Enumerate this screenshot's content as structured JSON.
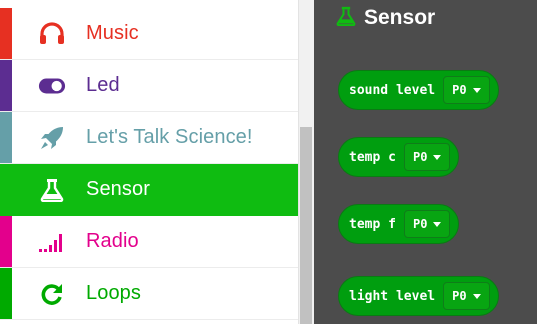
{
  "toolbox": {
    "categories": [
      {
        "label": "Music",
        "color": "#e63022",
        "icon": "headphones-icon"
      },
      {
        "label": "Led",
        "color": "#5c2d91",
        "icon": "toggle-icon"
      },
      {
        "label": "Let's Talk Science!",
        "color": "#659fa8",
        "icon": "rocket-icon"
      },
      {
        "label": "Sensor",
        "color": "#0fbc11",
        "icon": "flask-icon",
        "selected": true
      },
      {
        "label": "Radio",
        "color": "#e3008c",
        "icon": "signal-bars-icon"
      },
      {
        "label": "Loops",
        "color": "#00aa00",
        "icon": "loop-arrow-icon"
      }
    ]
  },
  "flyout": {
    "title": "Sensor",
    "title_icon": "flask-icon",
    "block_color": "#009e0f",
    "blocks": [
      {
        "label": "sound level",
        "pin": "P0"
      },
      {
        "label": "temp c",
        "pin": "P0"
      },
      {
        "label": "temp f",
        "pin": "P0"
      },
      {
        "label": "light level",
        "pin": "P0"
      }
    ]
  }
}
